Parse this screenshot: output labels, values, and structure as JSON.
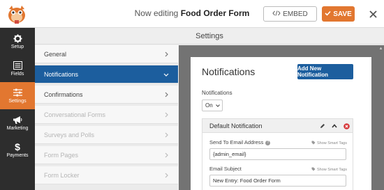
{
  "header": {
    "title_prefix": "Now editing",
    "form_name": "Food Order Form",
    "embed_label": "EMBED",
    "save_label": "SAVE"
  },
  "sidebar": {
    "items": [
      {
        "label": "Setup",
        "icon": "gear-icon"
      },
      {
        "label": "Fields",
        "icon": "fields-list-icon"
      },
      {
        "label": "Settings",
        "icon": "sliders-icon",
        "active": true
      },
      {
        "label": "Marketing",
        "icon": "megaphone-icon"
      },
      {
        "label": "Payments",
        "icon": "dollar-icon"
      }
    ]
  },
  "panel": {
    "title": "Settings"
  },
  "settings_nav": {
    "items": [
      {
        "label": "General",
        "state": "normal"
      },
      {
        "label": "Notifications",
        "state": "active"
      },
      {
        "label": "Confirmations",
        "state": "normal"
      },
      {
        "label": "Conversational Forms",
        "state": "disabled"
      },
      {
        "label": "Surveys and Polls",
        "state": "disabled"
      },
      {
        "label": "Form Pages",
        "state": "disabled"
      },
      {
        "label": "Form Locker",
        "state": "disabled"
      }
    ]
  },
  "notifications": {
    "title": "Notifications",
    "add_button": "Add New Notification",
    "toggle_label": "Notifications",
    "toggle_value": "On",
    "default_notification": {
      "name": "Default Notification",
      "send_to_label": "Send To Email Address",
      "send_to_value": "{admin_email}",
      "smart_tags": "Show Smart Tags",
      "subject_label": "Email Subject",
      "subject_value": "New Entry: Food Order Form"
    }
  },
  "colors": {
    "accent": "#e27730",
    "primary_blue": "#1c5e9e",
    "sidebar_dark": "#2d2d2d",
    "delete_red": "#d63638"
  }
}
